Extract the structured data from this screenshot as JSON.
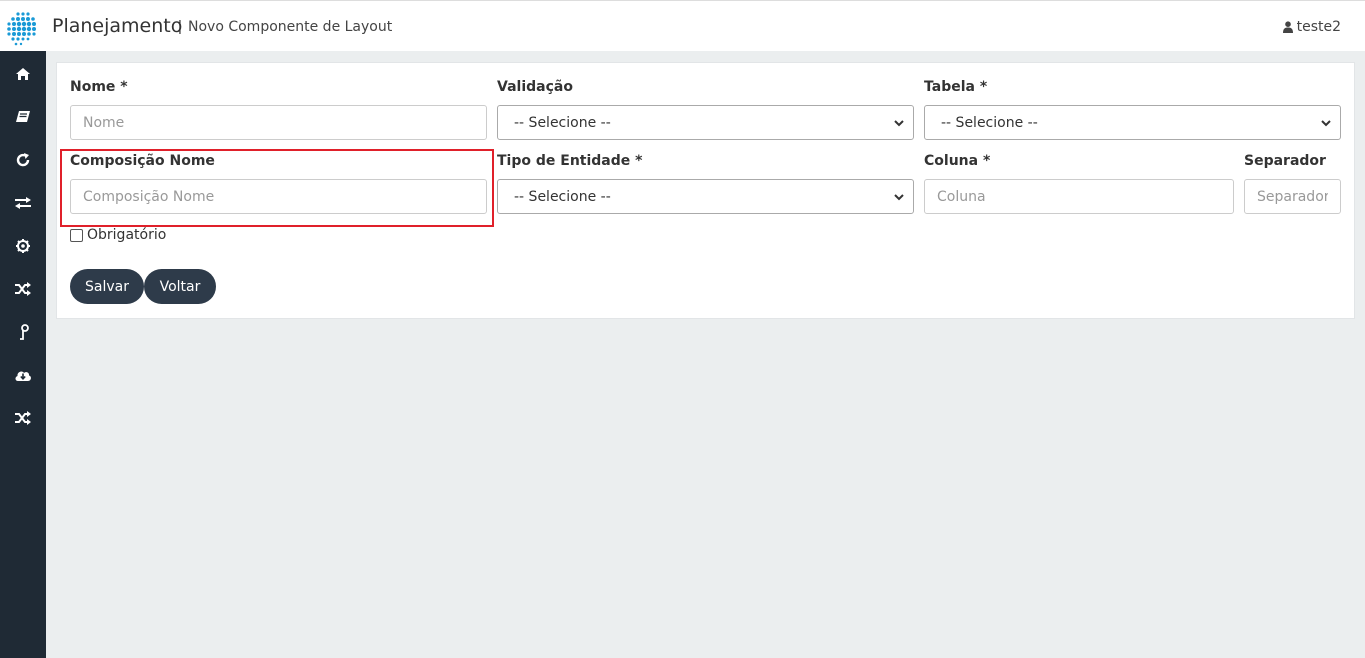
{
  "header": {
    "app_title": "Planejamento",
    "separator": "|",
    "subtitle": "Novo Componente de Layout",
    "user": "teste2"
  },
  "sidebar": {
    "items": [
      {
        "icon": "home-icon"
      },
      {
        "icon": "book-icon"
      },
      {
        "icon": "refresh-icon"
      },
      {
        "icon": "exchange-icon"
      },
      {
        "icon": "settings-icon"
      },
      {
        "icon": "shuffle-icon"
      },
      {
        "icon": "key-icon"
      },
      {
        "icon": "cloud-download-icon"
      },
      {
        "icon": "shuffle-icon"
      }
    ]
  },
  "form": {
    "nome": {
      "label": "Nome *",
      "placeholder": "Nome",
      "value": ""
    },
    "validacao": {
      "label": "Validação",
      "selected": "-- Selecione --"
    },
    "tabela": {
      "label": "Tabela *",
      "selected": "-- Selecione --"
    },
    "composicao": {
      "label": "Composição Nome",
      "placeholder": "Composição Nome",
      "value": ""
    },
    "tipo_entidade": {
      "label": "Tipo de Entidade *",
      "selected": "-- Selecione --"
    },
    "coluna": {
      "label": "Coluna *",
      "placeholder": "Coluna",
      "value": ""
    },
    "separador": {
      "label": "Separador",
      "placeholder": "Separador",
      "value": ""
    },
    "obrigatorio": {
      "label": "Obrigatório",
      "checked": false
    }
  },
  "buttons": {
    "save": "Salvar",
    "back": "Voltar"
  },
  "colors": {
    "sidebar": "#1f2a35",
    "button": "#2e3b4a",
    "highlight": "#e0202a",
    "logo": "#1a9ad6"
  }
}
